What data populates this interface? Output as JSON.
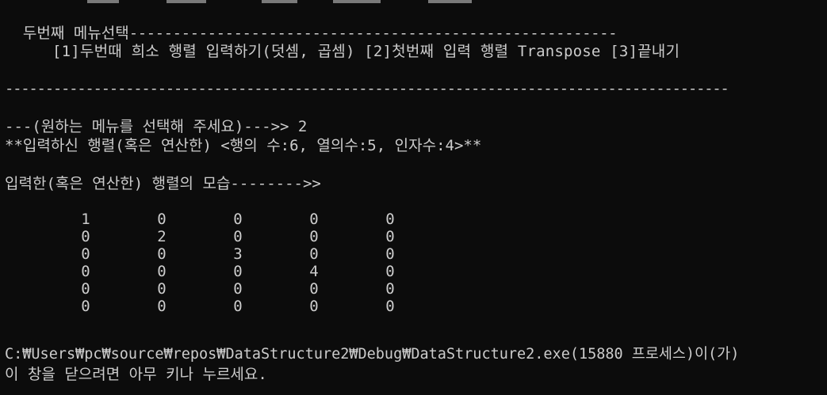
{
  "console": {
    "header_title": "두번째 메뉴선택",
    "header_dashes": "--------------------------------------------------------",
    "menu_line": "[1]두번때 희소 행렬 입력하기(덧셈, 곱셈) [2]첫번째 입력 행렬 Transpose [3]끝내기",
    "divider_dashes": "------------------------------------------------------------------------------------------",
    "prompt_line": "---(원하는 메뉴를 선택해 주세요)--->> 2",
    "info_line": "**입력하신 행렬(혹은 연산한) <행의 수:6, 열의수:5, 인자수:4>**",
    "shape_line": "입력한(혹은 연산한) 행렬의 모습-------->>",
    "matrix": [
      [
        "1",
        "0",
        "0",
        "0",
        "0"
      ],
      [
        "0",
        "2",
        "0",
        "0",
        "0"
      ],
      [
        "0",
        "0",
        "3",
        "0",
        "0"
      ],
      [
        "0",
        "0",
        "0",
        "4",
        "0"
      ],
      [
        "0",
        "0",
        "0",
        "0",
        "0"
      ],
      [
        "0",
        "0",
        "0",
        "0",
        "0"
      ]
    ],
    "exit_line_1": "C:₩Users₩pc₩source₩repos₩DataStructure2₩Debug₩DataStructure2.exe(15880 프로세스)이(가)",
    "exit_line_2": "이 창을 닫으려면 아무 키나 누르세요."
  }
}
